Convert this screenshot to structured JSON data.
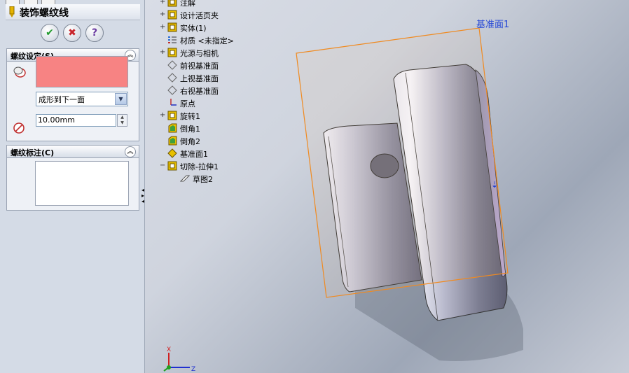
{
  "property_manager": {
    "title": "装饰螺纹线",
    "ok_label": "✔",
    "cancel_label": "✖",
    "help_label": "?",
    "thread_settings": {
      "header": "螺纹设定(S)",
      "end_condition": "成形到下一面",
      "diameter": "10.00mm"
    },
    "thread_callout": {
      "header": "螺纹标注(C)"
    }
  },
  "feature_tree": {
    "items": [
      {
        "label": "注解",
        "expander": "+",
        "icon": "annotations-icon",
        "color": "#e0b400"
      },
      {
        "label": "设计活页夹",
        "expander": "+",
        "icon": "design-binder-icon",
        "color": "#e8c000"
      },
      {
        "label": "实体(1)",
        "expander": "+",
        "icon": "solid-bodies-icon",
        "color": "#e0b400"
      },
      {
        "label": "材质 <未指定>",
        "expander": "",
        "icon": "material-icon",
        "color": "#2c6fd6"
      },
      {
        "label": "光源与相机",
        "expander": "+",
        "icon": "lights-camera-icon",
        "color": "#e8c000"
      },
      {
        "label": "前视基准面",
        "expander": "",
        "icon": "plane-icon",
        "color": "#808080"
      },
      {
        "label": "上视基准面",
        "expander": "",
        "icon": "plane-icon",
        "color": "#808080"
      },
      {
        "label": "右视基准面",
        "expander": "",
        "icon": "plane-icon",
        "color": "#808080"
      },
      {
        "label": "原点",
        "expander": "",
        "icon": "origin-icon",
        "color": "#c03030"
      },
      {
        "label": "旋转1",
        "expander": "+",
        "icon": "revolve-icon",
        "color": "#e8c000"
      },
      {
        "label": "倒角1",
        "expander": "",
        "icon": "chamfer-icon",
        "color": "#e8c000"
      },
      {
        "label": "倒角2",
        "expander": "",
        "icon": "chamfer-icon",
        "color": "#e8c000"
      },
      {
        "label": "基准面1",
        "expander": "",
        "icon": "plane-icon",
        "color": "#e8c000"
      },
      {
        "label": "切除-拉伸1",
        "expander": "−",
        "icon": "cut-extrude-icon",
        "color": "#e8c000"
      },
      {
        "label": "草图2",
        "expander": "",
        "icon": "sketch-icon",
        "color": "#555555"
      }
    ]
  },
  "viewport": {
    "plane_label": "基准面1",
    "triad": {
      "x_label": "X",
      "z_label": "Z"
    }
  },
  "colors": {
    "accent_plane": "#f08a20",
    "selection_fill": "#f78383",
    "ok_green": "#1f9a2a",
    "cancel_red": "#c8232a",
    "help_purple": "#6a3aa0"
  }
}
